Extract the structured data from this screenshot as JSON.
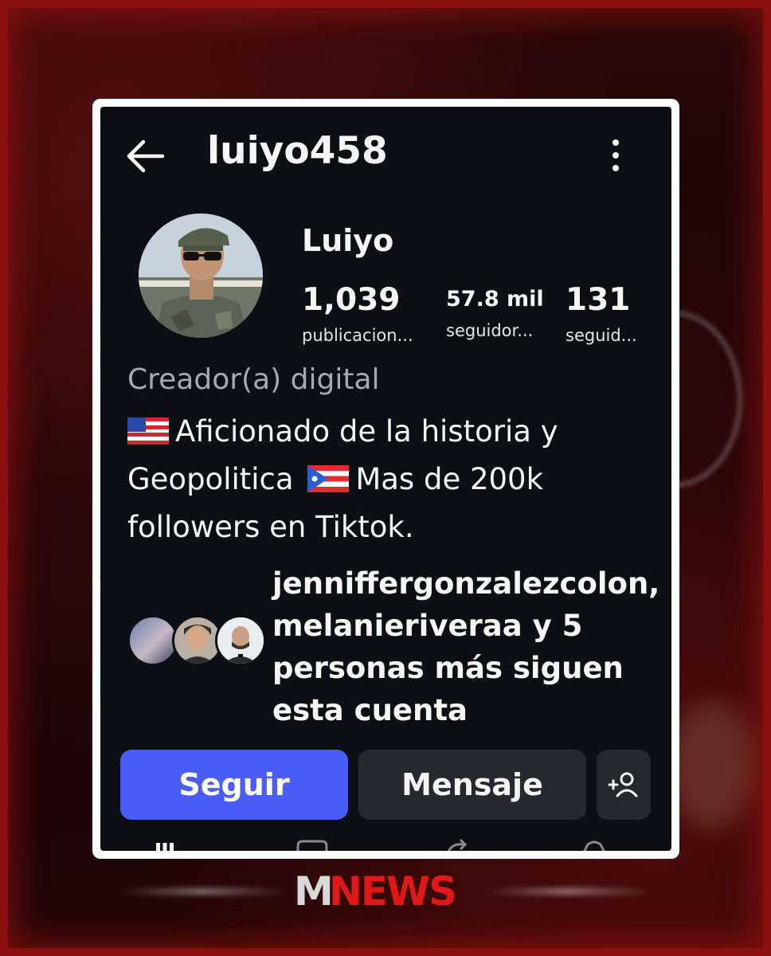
{
  "header": {
    "username": "luiyo458"
  },
  "profile": {
    "display_name": "Luiyo",
    "stats": {
      "posts_value": "1,039",
      "posts_label": "publicacion...",
      "followers_value": "57.8 mil",
      "followers_label": "seguidor...",
      "following_value": "131",
      "following_label": "seguid..."
    },
    "category": "Creador(a) digital",
    "bio": {
      "line1": "Aficionado de la historia y",
      "line2_a": "Geopolitica",
      "line2_b": "Mas de 200k",
      "line3": "followers en Tiktok."
    },
    "mutual_followers": "jenniffergonzalezcolon, melanieriveraa y 5 personas más siguen esta cuenta"
  },
  "actions": {
    "follow_label": "Seguir",
    "message_label": "Mensaje"
  },
  "icons": {
    "back": "arrow-left-icon",
    "more": "more-vertical-icon",
    "add_user": "add-user-icon",
    "us_flag": "us-flag-icon",
    "pr_flag": "puerto-rico-flag-icon"
  },
  "colors": {
    "screen_bg": "#0c1014",
    "follow_button": "#4a5df9",
    "secondary_button": "#25292e",
    "category_text": "#a8a8b3"
  }
}
